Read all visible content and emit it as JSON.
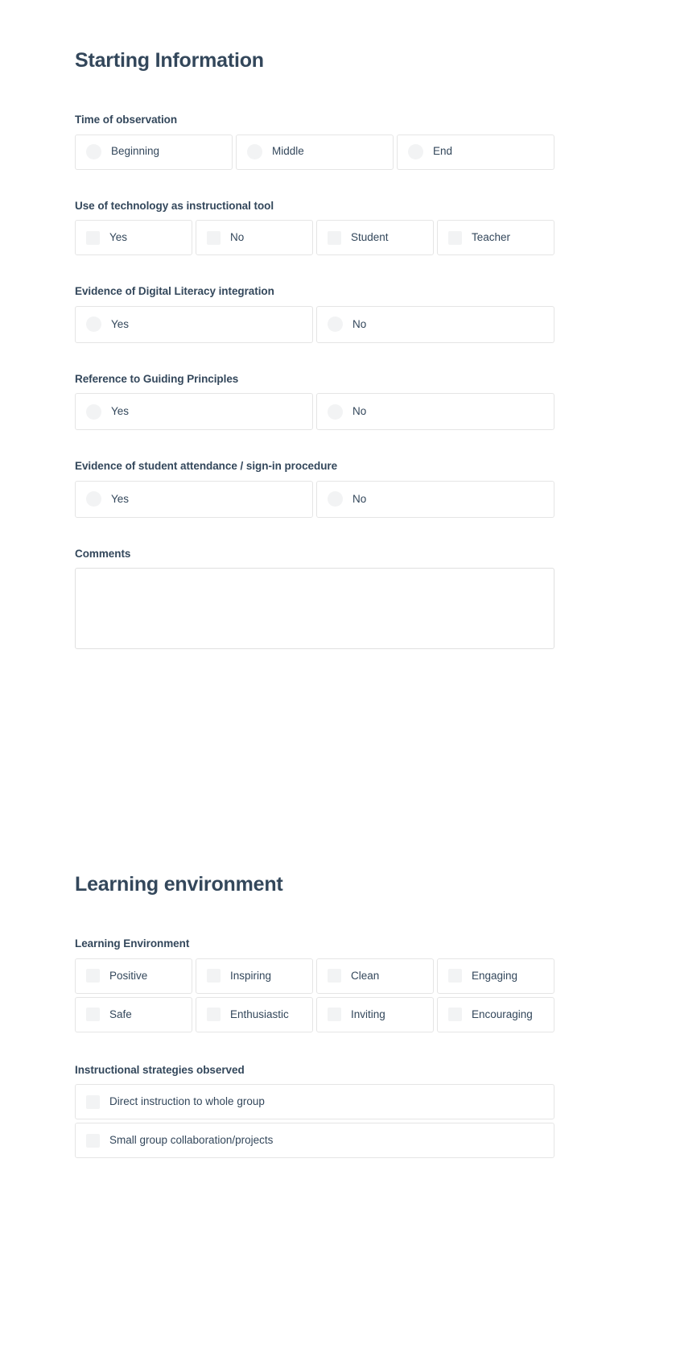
{
  "sections": [
    {
      "title": "Starting Information",
      "fields": [
        {
          "label": "Time of observation",
          "control": "radio",
          "columns": 3,
          "options": [
            "Beginning",
            "Middle",
            "End"
          ]
        },
        {
          "label": "Use of technology as instructional tool",
          "control": "checkbox",
          "columns": 4,
          "options": [
            "Yes",
            "No",
            "Student",
            "Teacher"
          ]
        },
        {
          "label": "Evidence of Digital Literacy integration",
          "control": "radio",
          "columns": 2,
          "options": [
            "Yes",
            "No"
          ]
        },
        {
          "label": "Reference to Guiding Principles",
          "control": "radio",
          "columns": 2,
          "options": [
            "Yes",
            "No"
          ]
        },
        {
          "label": "Evidence of student attendance / sign-in procedure",
          "control": "radio",
          "columns": 2,
          "options": [
            "Yes",
            "No"
          ]
        },
        {
          "label": "Comments",
          "control": "textarea",
          "value": "",
          "placeholder": ""
        }
      ]
    },
    {
      "title": "Learning environment",
      "fields": [
        {
          "label": "Learning Environment",
          "control": "checkbox",
          "columns": 4,
          "options": [
            "Positive",
            "Inspiring",
            "Clean",
            "Engaging",
            "Safe",
            "Enthusiastic",
            "Inviting",
            "Encouraging"
          ]
        },
        {
          "label": "Instructional strategies observed",
          "control": "checkbox",
          "columns": 1,
          "options": [
            "Direct instruction to whole group",
            "Small group collaboration/projects"
          ]
        }
      ]
    }
  ],
  "colors": {
    "heading": "#33475b",
    "label": "#33475b",
    "border": "#e5e5e5",
    "control_fill": "#f2f3f4",
    "background": "#ffffff"
  }
}
